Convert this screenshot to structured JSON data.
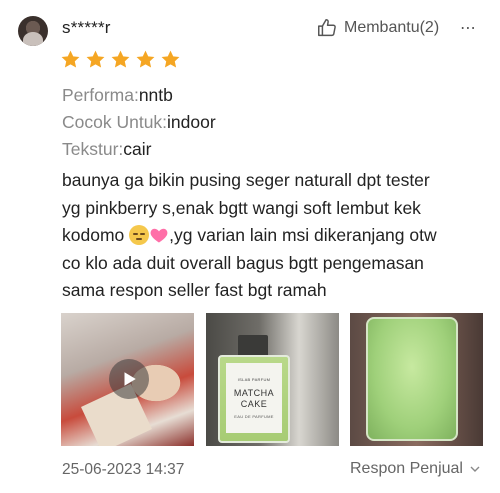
{
  "reviewer": {
    "username": "s*****r",
    "avatar_icon": "user-avatar"
  },
  "actions": {
    "helpful_label": "Membantu(2)",
    "helpful_icon": "thumbs-up-icon",
    "more_label": "⋯"
  },
  "rating": {
    "stars": 5,
    "max": 5,
    "star_color": "#f5a623"
  },
  "attributes": [
    {
      "key": "Performa:",
      "value": "nntb"
    },
    {
      "key": "Cocok Untuk:",
      "value": "indoor"
    },
    {
      "key": "Tekstur:",
      "value": "cair"
    }
  ],
  "review": {
    "line1": "baunya ga bikin pusing seger naturall dpt tester",
    "line2": "yg pinkberry s,enak bgtt wangi soft lembut kek",
    "line3_a": "kodomo ",
    "line3_b": ",yg varian lain msi dikeranjang otw",
    "line4": "co klo ada duit overall bagus bgtt pengemasan",
    "line5": "sama respon seller fast bgt ramah",
    "emojis": [
      "pensive-face",
      "pink-heart"
    ]
  },
  "media": {
    "item1": {
      "kind": "video",
      "icon": "play-icon"
    },
    "item2": {
      "kind": "image",
      "brand": "ISLAB PARFUM",
      "name_line1": "MATCHA",
      "name_line2": "CAKE",
      "subtitle": "EAU DE PARFUME"
    },
    "item3": {
      "kind": "image"
    }
  },
  "footer": {
    "date": "25-06-2023 14:37",
    "seller_response_label": "Respon Penjual",
    "chevron_icon": "chevron-down-icon"
  }
}
